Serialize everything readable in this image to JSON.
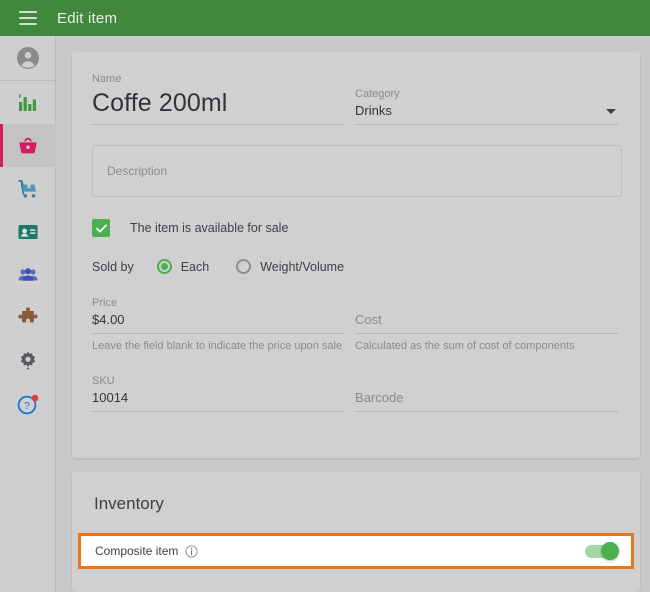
{
  "appbar": {
    "title": "Edit item",
    "menu_icon": "hamburger-menu-icon",
    "background_color": "#42883c"
  },
  "sidebar": {
    "items": [
      {
        "name": "account",
        "icon": "account-circle-icon",
        "color": "#8a8a8a",
        "active": false
      },
      {
        "name": "reports",
        "icon": "bar-chart-icon",
        "color": "#3e9a3e",
        "active": false
      },
      {
        "name": "items",
        "icon": "shopping-basket-icon",
        "color": "#d81b60",
        "active": true
      },
      {
        "name": "inventory",
        "icon": "delivery-cart-icon",
        "color": "#2e7fa8",
        "active": false
      },
      {
        "name": "customers",
        "icon": "id-card-icon",
        "color": "#1b7a6e",
        "active": false
      },
      {
        "name": "employees",
        "icon": "people-icon",
        "color": "#5b6bbf",
        "active": false
      },
      {
        "name": "integrations",
        "icon": "puzzle-piece-icon",
        "color": "#8a5a3b",
        "active": false
      },
      {
        "name": "settings",
        "icon": "gear-icon",
        "color": "#555b61",
        "active": false
      },
      {
        "name": "help",
        "icon": "help-circle-icon",
        "color": "#1976d2",
        "active": false,
        "badge_color": "#e53935"
      }
    ],
    "active_indicator_color": "#d81b60"
  },
  "form": {
    "name": {
      "label": "Name",
      "value": "Coffe 200ml"
    },
    "category": {
      "label": "Category",
      "value": "Drinks",
      "caret_icon": "chevron-down-icon"
    },
    "description": {
      "placeholder": "Description",
      "value": ""
    },
    "available_for_sale": {
      "label": "The item is available for sale",
      "checked": true,
      "check_icon": "checkmark-icon"
    },
    "sold_by": {
      "label": "Sold by",
      "options": [
        {
          "label": "Each",
          "selected": true
        },
        {
          "label": "Weight/Volume",
          "selected": false
        }
      ]
    },
    "price": {
      "label": "Price",
      "value": "$4.00",
      "help": "Leave the field blank to indicate the price upon sale"
    },
    "cost": {
      "placeholder": "Cost",
      "value": "",
      "help": "Calculated as the sum of cost of components"
    },
    "sku": {
      "label": "SKU",
      "value": "10014"
    },
    "barcode": {
      "placeholder": "Barcode",
      "value": ""
    }
  },
  "inventory": {
    "title": "Inventory",
    "composite_item": {
      "label": "Composite item",
      "info_icon": "info-circle-icon",
      "toggle_on": true,
      "toggle_color": "#4caf50",
      "highlight_color": "#e8761b"
    }
  }
}
